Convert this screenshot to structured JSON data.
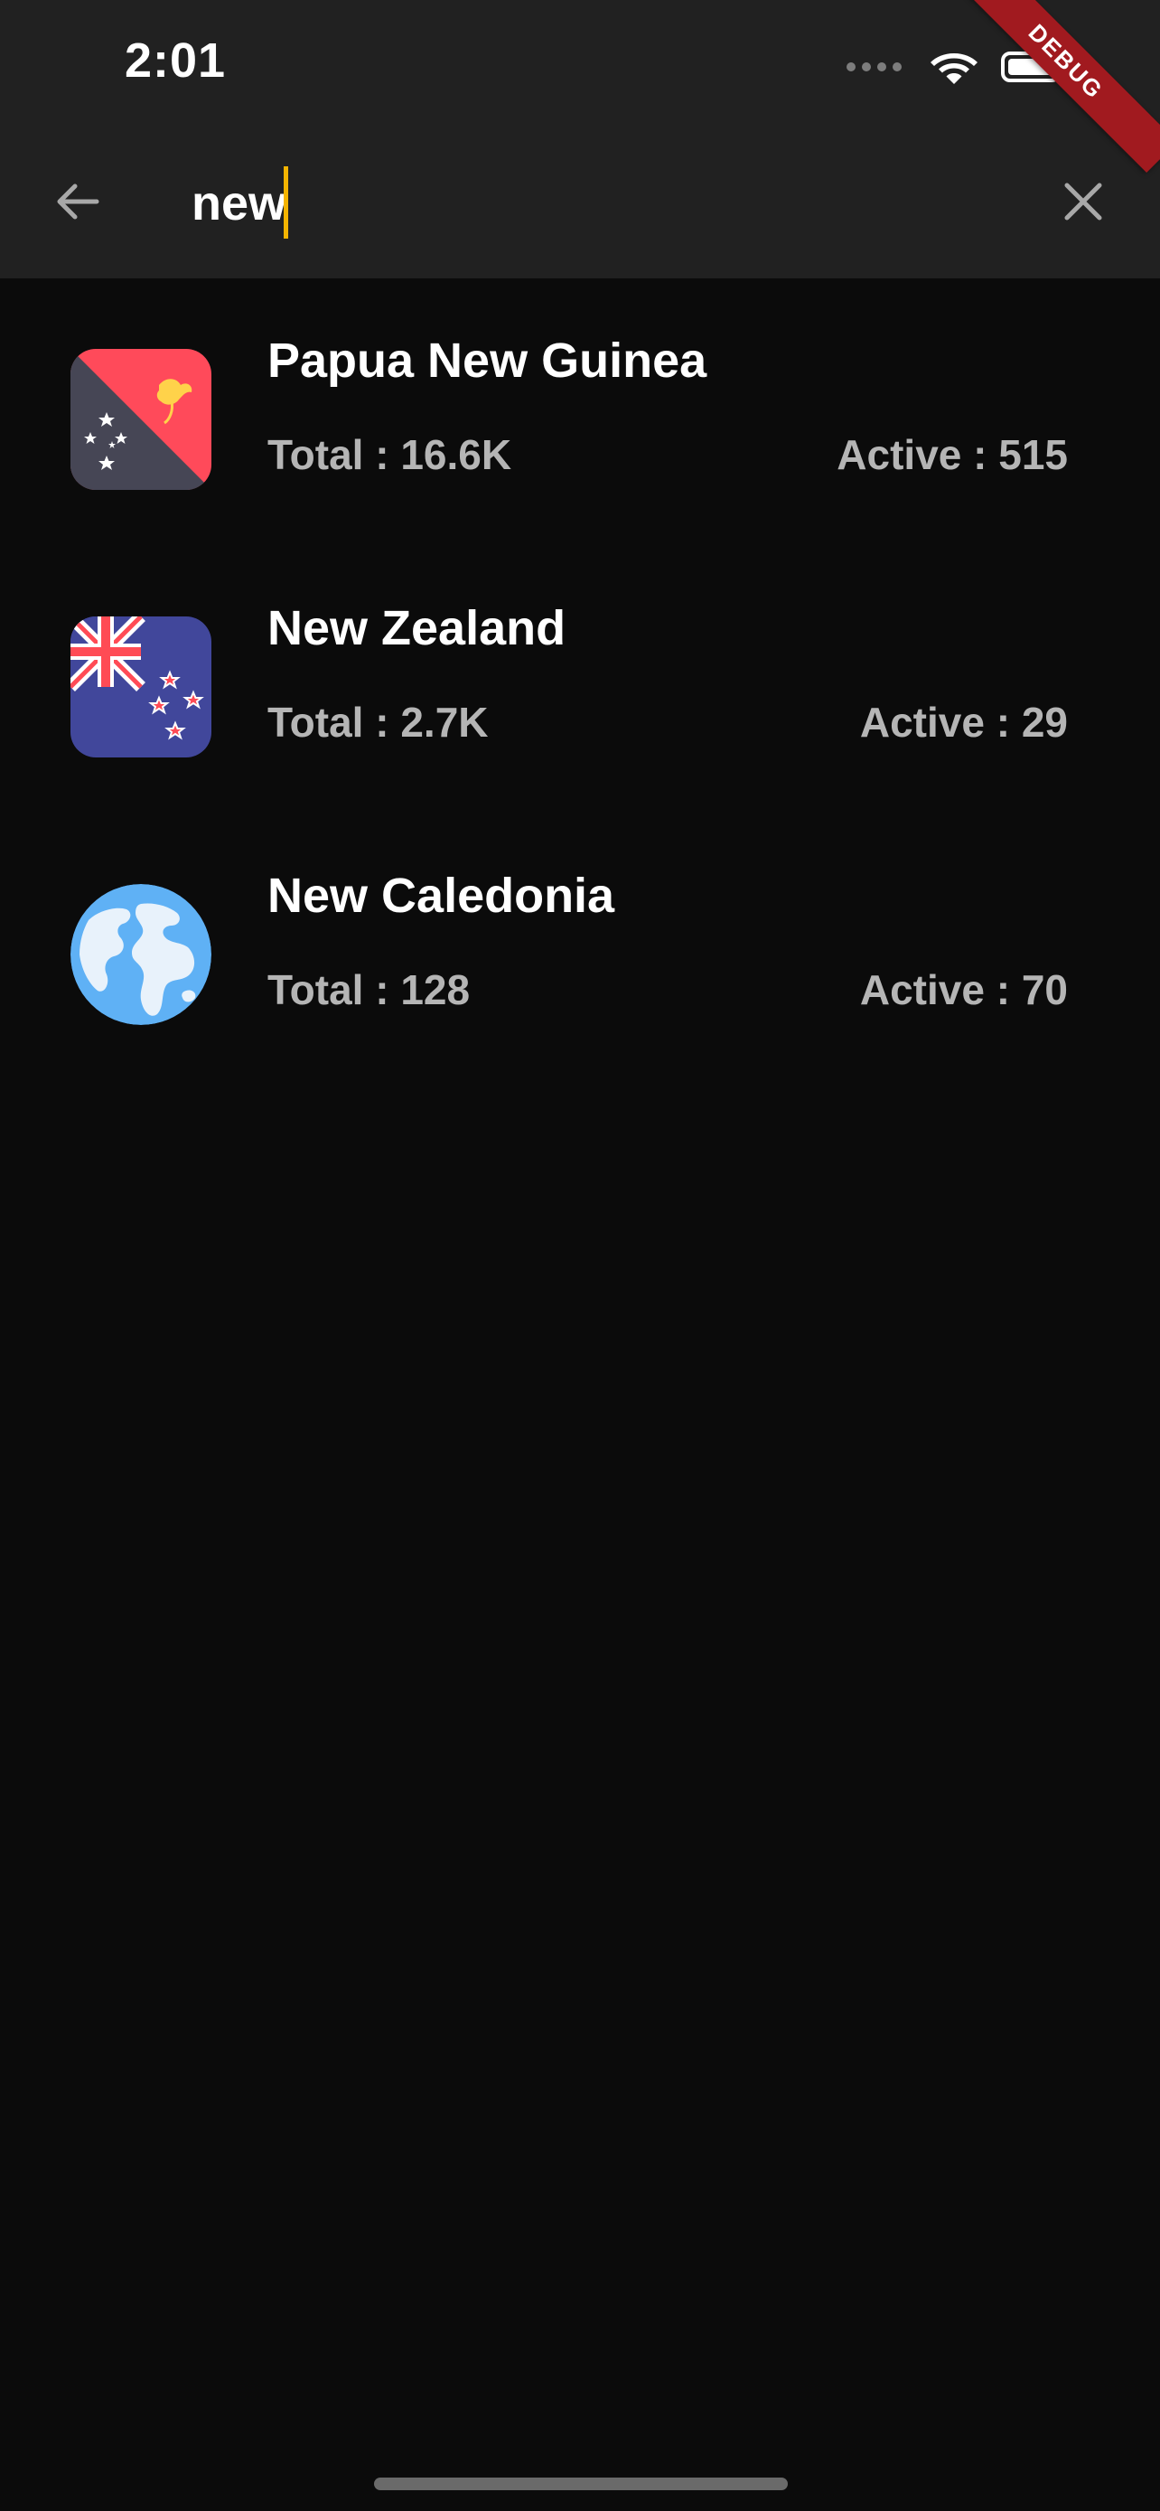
{
  "status_bar": {
    "time": "2:01",
    "debug_label": "DEBUG"
  },
  "app_bar": {
    "search_value": "new",
    "back_icon": "arrow-left-icon",
    "clear_icon": "close-icon"
  },
  "results": [
    {
      "name": "Papua New Guinea",
      "total": "Total : 16.6K",
      "active": "Active : 515",
      "flag_icon": "papua-new-guinea-flag-icon"
    },
    {
      "name": "New Zealand",
      "total": "Total : 2.7K",
      "active": "Active : 29",
      "flag_icon": "new-zealand-flag-icon"
    },
    {
      "name": "New Caledonia",
      "total": "Total : 128",
      "active": "Active : 70",
      "flag_icon": "globe-icon"
    }
  ],
  "colors": {
    "background": "#0b0b0b",
    "app_bar": "#212121",
    "caret": "#f4b400",
    "debug_ribbon": "#a11a1f"
  }
}
